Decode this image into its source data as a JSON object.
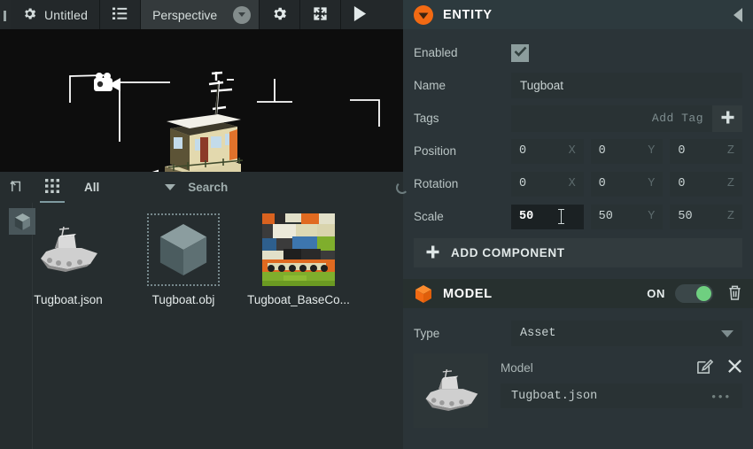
{
  "toolbar": {
    "project_name": "Untitled",
    "gear_icon": "gear-icon",
    "hierarchy_icon": "list-icon",
    "camera_mode": "Perspective",
    "camera_dropdown_icon": "chevron-down-circle-icon",
    "settings_icon": "gear-icon",
    "fullscreen_icon": "expand-icon",
    "play_icon": "play-icon"
  },
  "viewport": {
    "gizmo": {
      "x_axis_color": "#e03020",
      "y_axis_color": "#2fc02f",
      "z_axis_color": "#2a52e0"
    },
    "selection_outline_color": "#ffffff",
    "background_color": "#0d0d0d",
    "grid_color": "#d8d8d8",
    "camera_icon": "camera-icon"
  },
  "assetbar": {
    "upload_icon": "upload-icon",
    "grid_view_icon": "grid-view-icon",
    "filter_label": "All",
    "filter_caret_icon": "chevron-down-icon",
    "search_placeholder": "Search",
    "refresh_icon": "refresh-icon"
  },
  "assets": [
    {
      "name": "Tugboat.json",
      "thumb": "boat-thumbnail",
      "badge_icon": "cube-icon",
      "selected": true
    },
    {
      "name": "Tugboat.obj",
      "thumb": "cube-placeholder",
      "badge_icon": "",
      "selected": false
    },
    {
      "name": "Tugboat_BaseCo...",
      "thumb": "texture-thumbnail",
      "badge_icon": "",
      "selected": false
    }
  ],
  "entity": {
    "header": {
      "icon": "entity-orange-icon",
      "title": "ENTITY",
      "collapse_icon": "collapse-left-icon"
    },
    "enabled": {
      "label": "Enabled",
      "checked": true,
      "check_icon": "check-icon"
    },
    "name": {
      "label": "Name",
      "value": "Tugboat"
    },
    "tags": {
      "label": "Tags",
      "placeholder": "Add Tag",
      "add_icon": "plus-icon"
    },
    "position": {
      "label": "Position",
      "x": "0",
      "y": "0",
      "z": "0",
      "axis_x": "X",
      "axis_y": "Y",
      "axis_z": "Z"
    },
    "rotation": {
      "label": "Rotation",
      "x": "0",
      "y": "0",
      "z": "0",
      "axis_x": "X",
      "axis_y": "Y",
      "axis_z": "Z"
    },
    "scale": {
      "label": "Scale",
      "x": "50",
      "y": "50",
      "z": "50",
      "axis_x": "X",
      "axis_y": "Y",
      "axis_z": "Z",
      "focused_field": "x"
    },
    "add_component": {
      "label": "ADD COMPONENT",
      "icon": "plus-icon"
    }
  },
  "model": {
    "header": {
      "icon": "model-cube-orange-icon",
      "title": "MODEL",
      "toggle_label": "ON",
      "toggle_on": true,
      "delete_icon": "trash-icon"
    },
    "type": {
      "label": "Type",
      "value": "Asset",
      "caret_icon": "chevron-down-icon"
    },
    "asset_slot": {
      "label": "Model",
      "thumb": "boat-thumbnail",
      "edit_icon": "edit-pencil-icon",
      "clear_icon": "close-x-icon",
      "filename": "Tugboat.json",
      "more_icon": "ellipsis-icon"
    }
  },
  "colors": {
    "accent_orange": "#f26a13",
    "toggle_green": "#6fcf80",
    "panel_bg": "#2b3438",
    "field_bg": "#293234",
    "toolbar_bg": "#23282a"
  }
}
